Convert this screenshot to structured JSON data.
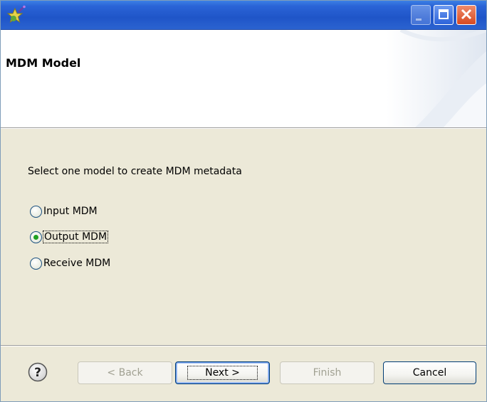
{
  "window": {
    "title": "",
    "title_bar_color": "#2a63d6"
  },
  "icons": {
    "app": "wizard-star-icon",
    "minimize": "minimize-icon",
    "maximize": "maximize-icon",
    "close": "close-icon",
    "help": "help-icon"
  },
  "banner": {
    "title": "MDM Model"
  },
  "body": {
    "prompt": "Select one model to create MDM metadata",
    "options": [
      {
        "label": "Input MDM",
        "selected": false
      },
      {
        "label": "Output MDM",
        "selected": true
      },
      {
        "label": "Receive MDM",
        "selected": false
      }
    ]
  },
  "footer": {
    "back_label": "< Back",
    "next_label": "Next >",
    "finish_label": "Finish",
    "cancel_label": "Cancel",
    "back_enabled": false,
    "next_enabled": true,
    "finish_enabled": false,
    "cancel_enabled": true
  }
}
